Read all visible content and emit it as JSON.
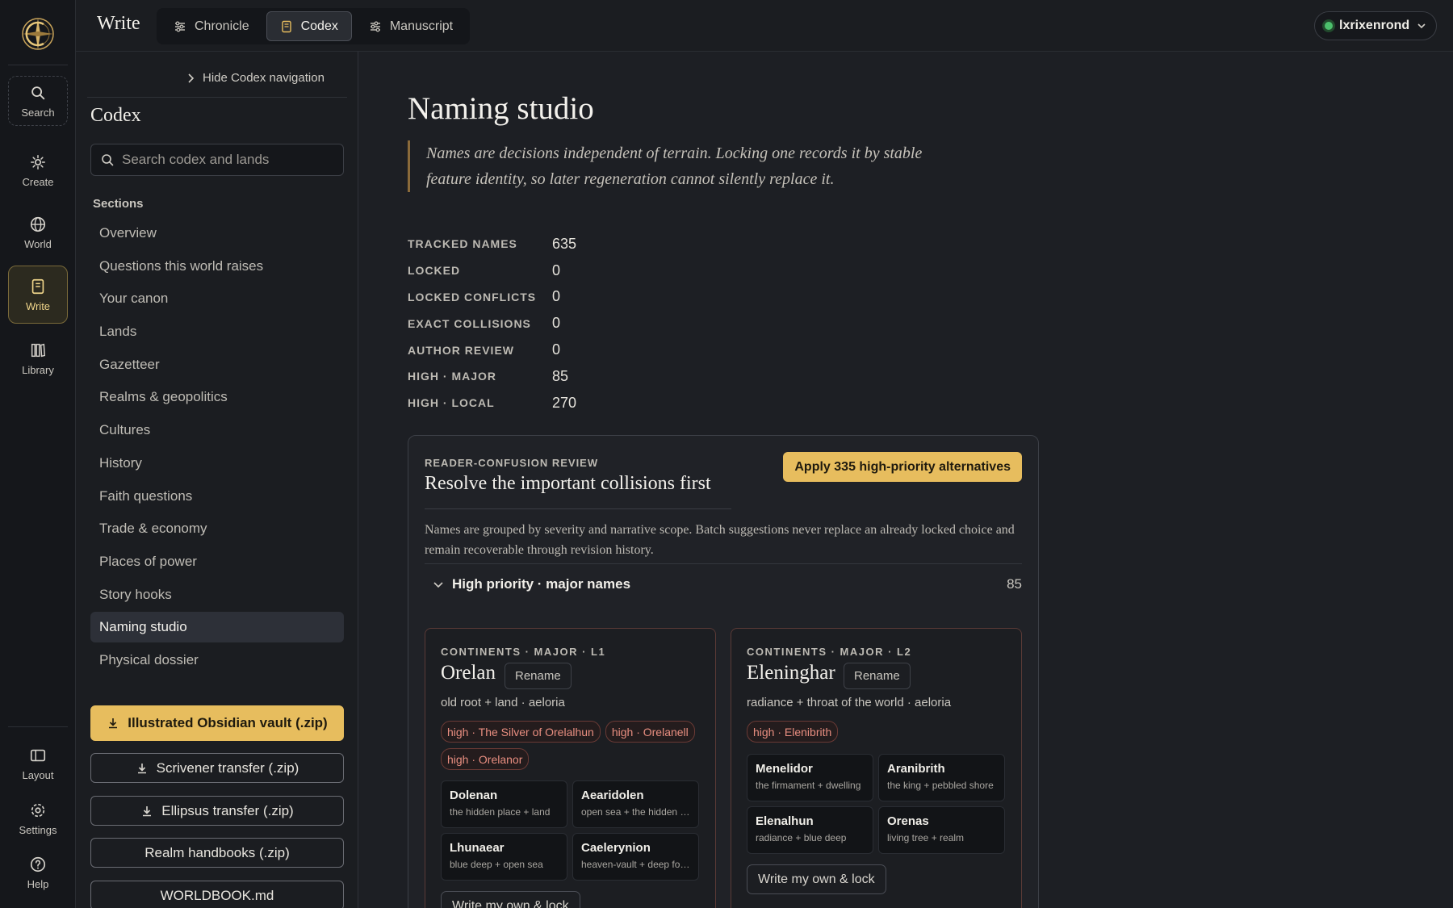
{
  "app": {
    "title": "Write"
  },
  "rail": {
    "items": [
      {
        "label": "Search",
        "icon": "search-icon"
      },
      {
        "label": "Create",
        "icon": "sparkle-icon"
      },
      {
        "label": "World",
        "icon": "globe-icon"
      },
      {
        "label": "Write",
        "icon": "book-icon",
        "active": true
      },
      {
        "label": "Library",
        "icon": "library-icon"
      },
      {
        "label": "Layout",
        "icon": "layout-icon"
      },
      {
        "label": "Settings",
        "icon": "gear-icon"
      },
      {
        "label": "Help",
        "icon": "help-icon"
      }
    ]
  },
  "tabs": [
    {
      "label": "Chronicle",
      "icon": "sliders-icon"
    },
    {
      "label": "Codex",
      "icon": "document-icon",
      "active": true
    },
    {
      "label": "Manuscript",
      "icon": "sliders-icon"
    }
  ],
  "user": {
    "name": "lxrixenrond",
    "status_color": "#4cbf6c"
  },
  "codex_nav": {
    "hide_label": "Hide Codex navigation",
    "title": "Codex",
    "search_placeholder": "Search codex and lands",
    "sections_label": "Sections",
    "sections": [
      "Overview",
      "Questions this world raises",
      "Your canon",
      "Lands",
      "Gazetteer",
      "Realms & geopolitics",
      "Cultures",
      "History",
      "Faith questions",
      "Trade & economy",
      "Places of power",
      "Story hooks",
      "Naming studio",
      "Physical dossier"
    ],
    "active_section": "Naming studio",
    "exports": {
      "obsidian": "Illustrated Obsidian vault (.zip)",
      "scrivener": "Scrivener transfer (.zip)",
      "ellipsus": "Ellipsus transfer (.zip)",
      "realm": "Realm handbooks (.zip)",
      "worldbook": "WORLDBOOK.md"
    }
  },
  "main": {
    "title": "Naming studio",
    "quote": "Names are decisions independent of terrain. Locking one records it by stable feature identity, so later regeneration cannot silently replace it.",
    "stats": [
      {
        "label": "TRACKED NAMES",
        "value": "635"
      },
      {
        "label": "LOCKED",
        "value": "0"
      },
      {
        "label": "LOCKED CONFLICTS",
        "value": "0"
      },
      {
        "label": "EXACT COLLISIONS",
        "value": "0"
      },
      {
        "label": "AUTHOR REVIEW",
        "value": "0"
      },
      {
        "label": "HIGH · MAJOR",
        "value": "85"
      },
      {
        "label": "HIGH · LOCAL",
        "value": "270"
      }
    ],
    "review": {
      "eyebrow": "READER-CONFUSION REVIEW",
      "title": "Resolve the important collisions first",
      "apply_label": "Apply 335 high-priority alternatives",
      "description": "Names are grouped by severity and narrative scope. Batch suggestions never replace an already locked choice and remain recoverable through revision history.",
      "group": {
        "label": "High priority · major names",
        "count": "85"
      },
      "rename_label": "Rename",
      "own_label": "Write my own & lock",
      "cards": [
        {
          "eyebrow": "CONTINENTS · MAJOR · L1",
          "name": "Orelan",
          "etymology": "old root + land · aeloria",
          "chips": [
            "high · The Silver of Orelalhun",
            "high · Orelanell",
            "high · Orelanor"
          ],
          "alternatives": [
            {
              "name": "Dolenan",
              "etym": "the hidden place + land"
            },
            {
              "name": "Aearidolen",
              "etym": "open sea + the hidden place"
            },
            {
              "name": "Lhunaear",
              "etym": "blue deep + open sea"
            },
            {
              "name": "Caelerynion",
              "etym": "heaven-vault + deep forest"
            }
          ]
        },
        {
          "eyebrow": "CONTINENTS · MAJOR · L2",
          "name": "Eleninghar",
          "etymology": "radiance + throat of the world · aeloria",
          "chips": [
            "high · Elenibrith"
          ],
          "alternatives": [
            {
              "name": "Menelidor",
              "etym": "the firmament + dwelling"
            },
            {
              "name": "Aranibrith",
              "etym": "the king + pebbled shore"
            },
            {
              "name": "Elenalhun",
              "etym": "radiance + blue deep"
            },
            {
              "name": "Orenas",
              "etym": "living tree + realm"
            }
          ]
        }
      ]
    }
  }
}
